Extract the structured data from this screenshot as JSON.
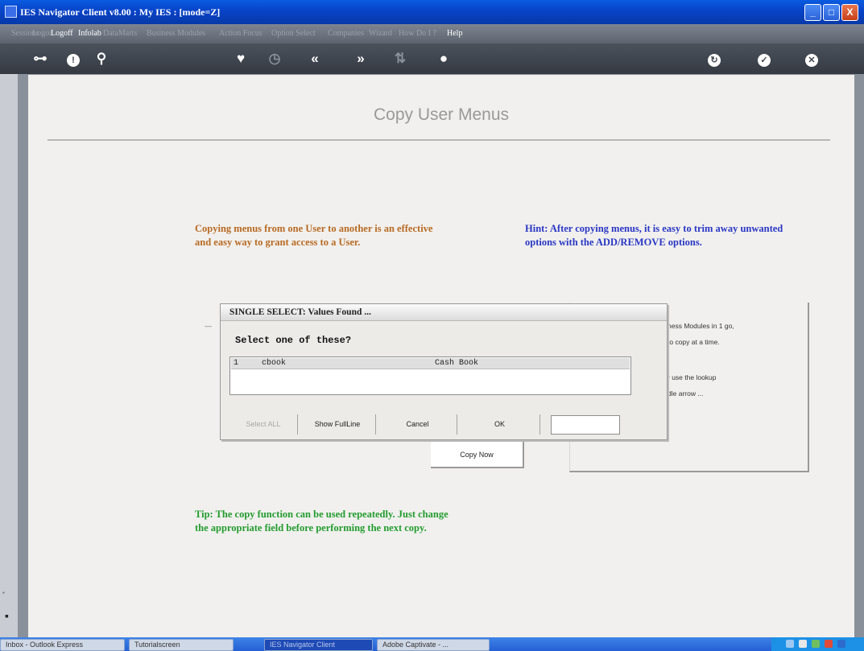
{
  "window": {
    "title": "IES Navigator Client v8.00 : My IES :     [mode=Z]",
    "controls": {
      "minimize": "_",
      "maximize": "□",
      "close": "X"
    }
  },
  "menubar": {
    "items": [
      {
        "label": "Sessions",
        "enabled": false
      },
      {
        "label": "Logon",
        "enabled": false
      },
      {
        "label": "Logoff",
        "enabled": true
      },
      {
        "label": "Infolab",
        "enabled": true
      },
      {
        "label": "DataMarts",
        "enabled": false
      },
      {
        "label": "Business Modules",
        "enabled": false
      },
      {
        "label": "Action Focus",
        "enabled": false
      },
      {
        "label": "Option Select",
        "enabled": false
      },
      {
        "label": "Companies",
        "enabled": false
      },
      {
        "label": "Wizard",
        "enabled": false
      },
      {
        "label": "How Do I ?",
        "enabled": false
      },
      {
        "label": "Help",
        "enabled": true
      }
    ]
  },
  "toolbar": {
    "icons": [
      "key-icon",
      "info-icon",
      "search-icon",
      "heart-icon",
      "clock-icon",
      "rewind-icon",
      "forward-icon",
      "sort-icon",
      "stop-icon",
      "recycle-icon",
      "check-icon",
      "close-icon"
    ]
  },
  "page": {
    "title": "Copy User Menus",
    "intro": "Copying menus from one User to another is an effective and easy way to grant access to a User.",
    "hint": "Hint: After copying menus, it is easy to trim away unwanted options with the ADD/REMOVE options.",
    "tip": "Tip: The copy function can be used repeatedly. Just change the appropriate field before performing the next copy.",
    "side_text": {
      "line1": "ness Modules in 1 go,",
      "line2": "to copy at a time.",
      "line3": "r use the lookup",
      "line4": "dle arrow ..."
    },
    "copy_now_label": "Copy Now"
  },
  "dialog": {
    "title": "SINGLE SELECT: Values Found ...",
    "prompt": "Select one of these?",
    "rows": [
      {
        "num": "1",
        "code": "cbook",
        "desc": "Cash Book"
      }
    ],
    "buttons": {
      "select_all": "Select ALL",
      "show_full_line": "Show FullLine",
      "cancel": "Cancel",
      "ok": "OK"
    },
    "input_value": ""
  },
  "taskbar": {
    "items": [
      "Inbox - Outlook Express",
      "Tutorialscreen",
      "IES Navigator Client",
      "Adobe Captivate - ..."
    ]
  }
}
